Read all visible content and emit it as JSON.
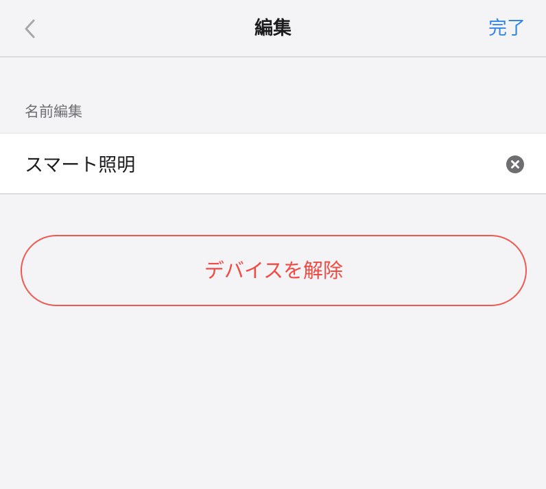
{
  "nav": {
    "back_icon": "chevron-left-icon",
    "title": "編集",
    "done_label": "完了"
  },
  "name_section": {
    "label": "名前編集",
    "value": "スマート照明",
    "clear_icon": "clear-circle-icon"
  },
  "actions": {
    "remove_label": "デバイスを解除"
  },
  "colors": {
    "background": "#f4f4f6",
    "accent": "#2f86ea",
    "danger": "#f04a42",
    "secondary_text": "#6e6e73"
  }
}
